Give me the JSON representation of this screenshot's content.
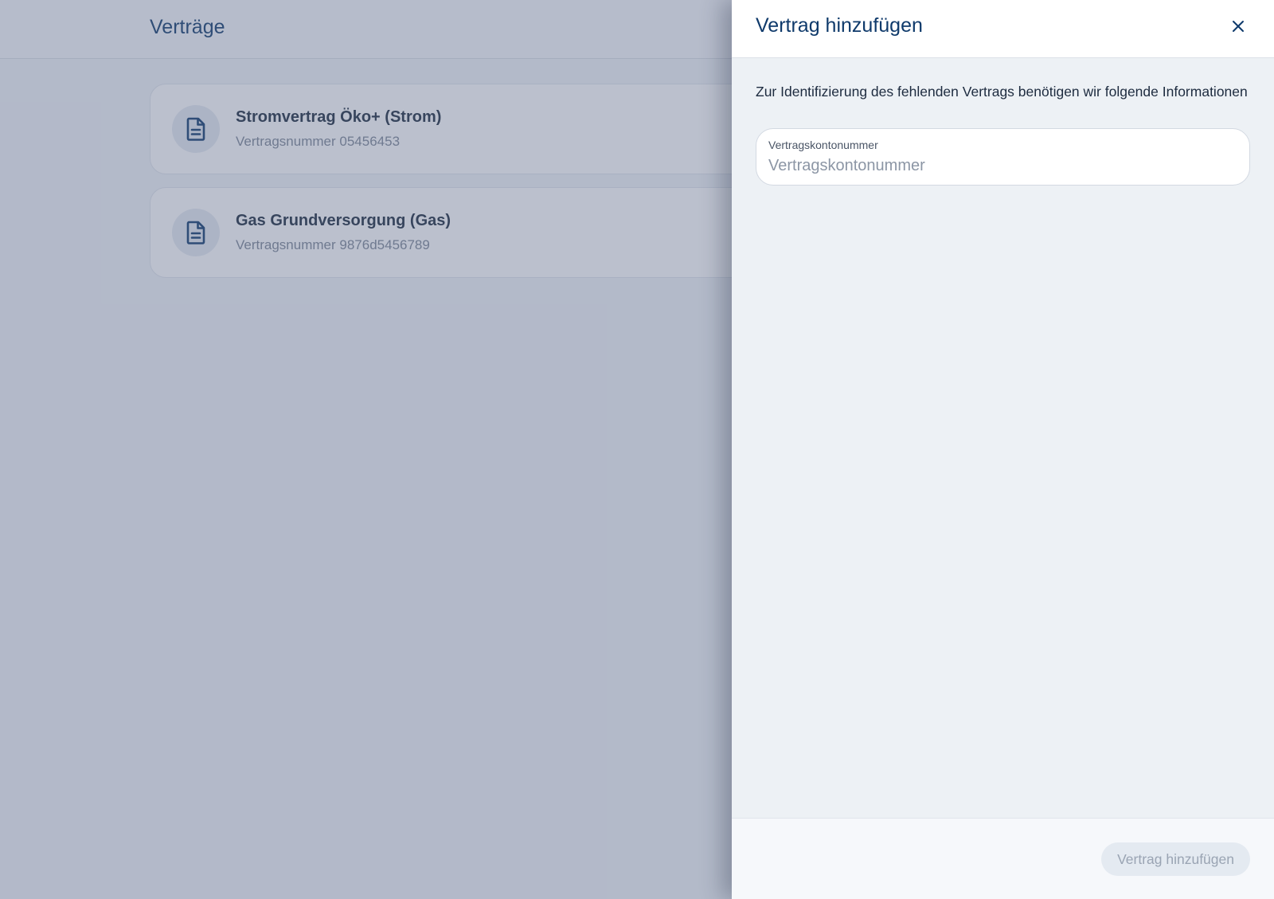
{
  "header": {
    "title": "Verträge"
  },
  "contracts": [
    {
      "title": "Stromvertrag Öko+ (Strom)",
      "subtitle": "Vertragsnummer 05456453",
      "icon": "document-icon"
    },
    {
      "title": "Gas Grundversorgung (Gas)",
      "subtitle": "Vertragsnummer 9876d5456789",
      "icon": "document-icon"
    }
  ],
  "drawer": {
    "title": "Vertrag hinzufügen",
    "close_icon": "close-icon",
    "intro": "Zur Identifizierung des fehlenden Vertrags benötigen wir folgende Informationen",
    "field": {
      "label": "Vertragskontonummer",
      "placeholder": "Vertragskontonummer",
      "value": ""
    },
    "submit_label": "Vertrag hinzufügen",
    "submit_disabled": true
  },
  "colors": {
    "primary": "#0f3a6b",
    "overlay": "rgba(92,104,136,0.42)",
    "disabled_button_bg": "#e4eaf1",
    "disabled_button_text": "#9aa4b3"
  }
}
